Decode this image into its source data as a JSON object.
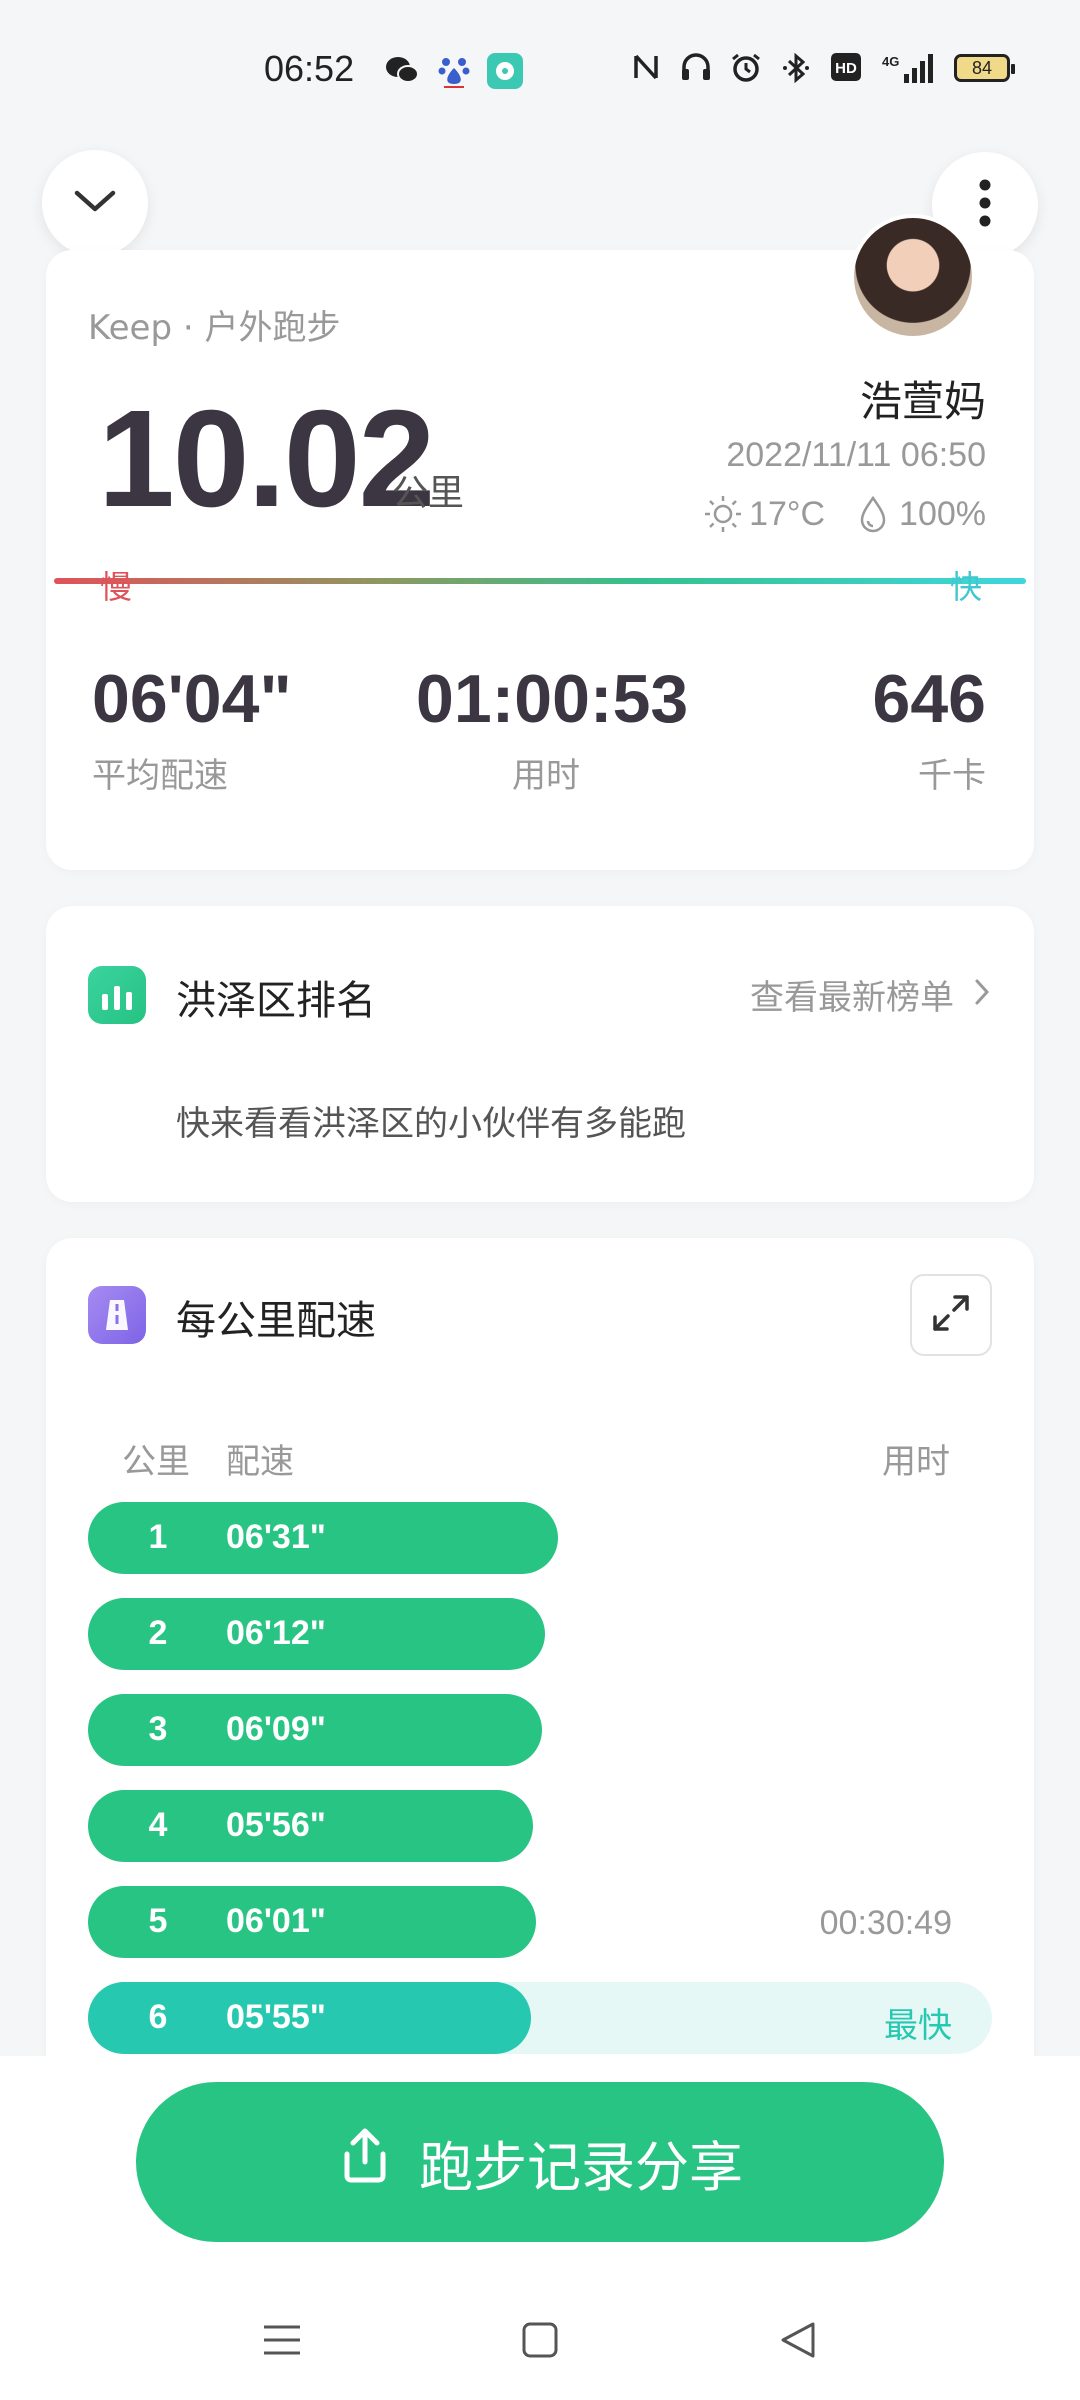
{
  "status_bar": {
    "time": "06:52",
    "battery": "84",
    "icons": [
      "wechat-icon",
      "baidu-icon",
      "app-icon",
      "nfc-icon",
      "headset-icon",
      "alarm-icon",
      "bluetooth-icon",
      "hd-icon",
      "signal-4g-icon",
      "battery-icon"
    ]
  },
  "summary": {
    "source": "Keep · 户外跑步",
    "distance": "10.02",
    "distance_unit": "公里",
    "username": "浩萱妈",
    "datetime": "2022/11/11 06:50",
    "temperature": "17°C",
    "humidity": "100%",
    "pace_slow_label": "慢",
    "pace_fast_label": "快",
    "stats": {
      "avg_pace": {
        "value": "06'04\"",
        "label": "平均配速"
      },
      "duration": {
        "value": "01:00:53",
        "label": "用时"
      },
      "calories": {
        "value": "646",
        "label": "千卡"
      }
    }
  },
  "ranking": {
    "title": "洪泽区排名",
    "link": "查看最新榜单",
    "subtitle": "快来看看洪泽区的小伙伴有多能跑"
  },
  "pace_table": {
    "title": "每公里配速",
    "headers": {
      "km": "公里",
      "pace": "配速",
      "time": "用时"
    },
    "rows": [
      {
        "km": "1",
        "pace": "06'31\"",
        "time": "",
        "tag": "",
        "fill": 0.52
      },
      {
        "km": "2",
        "pace": "06'12\"",
        "time": "",
        "tag": "",
        "fill": 0.505
      },
      {
        "km": "3",
        "pace": "06'09\"",
        "time": "",
        "tag": "",
        "fill": 0.502
      },
      {
        "km": "4",
        "pace": "05'56\"",
        "time": "",
        "tag": "",
        "fill": 0.492
      },
      {
        "km": "5",
        "pace": "06'01\"",
        "time": "00:30:49",
        "tag": "",
        "fill": 0.496
      },
      {
        "km": "6",
        "pace": "05'55\"",
        "time": "",
        "tag": "最快",
        "fill": 0.49
      }
    ]
  },
  "share": {
    "label": "跑步记录分享"
  },
  "colors": {
    "accent": "#28c483",
    "fastest": "#27c8b0",
    "slow": "#e0525a"
  }
}
